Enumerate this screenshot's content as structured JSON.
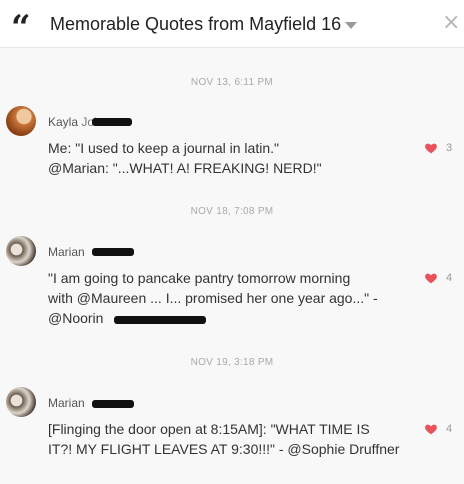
{
  "header": {
    "quote_glyph": "“",
    "title": "Memorable Quotes from Mayfield 16",
    "close_glyph": "×"
  },
  "messages": [
    {
      "date": "NOV 13, 6:11 PM",
      "sender": "Kayla",
      "sender_partial": "Joh",
      "lines": [
        "Me: \"I used to keep a journal in latin.\"",
        "@Marian: \"...WHAT! A! FREAKING! NERD!\""
      ],
      "likes": "3"
    },
    {
      "date": "NOV 18, 7:08 PM",
      "sender": "Marian",
      "lines": [
        "\"I am going to pancake pantry tomorrow morning",
        "with @Maureen ... I... promised her one year ago...\" -",
        "@Noorin"
      ],
      "likes": "4"
    },
    {
      "date": "NOV 19, 3:18 PM",
      "sender": "Marian",
      "lines": [
        "[Flinging the door open at 8:15AM]: \"WHAT TIME IS",
        "IT?! MY FLIGHT LEAVES AT 9:30!!!\" - @Sophie Druffner"
      ],
      "likes": "4"
    }
  ],
  "colors": {
    "heart": "#e8525a",
    "background": "#f8f8f8",
    "date_text": "#a9a9a9"
  },
  "icons": {
    "quote": "quote-icon",
    "dropdown": "chevron-down-icon",
    "close": "close-icon",
    "like": "heart-icon"
  }
}
